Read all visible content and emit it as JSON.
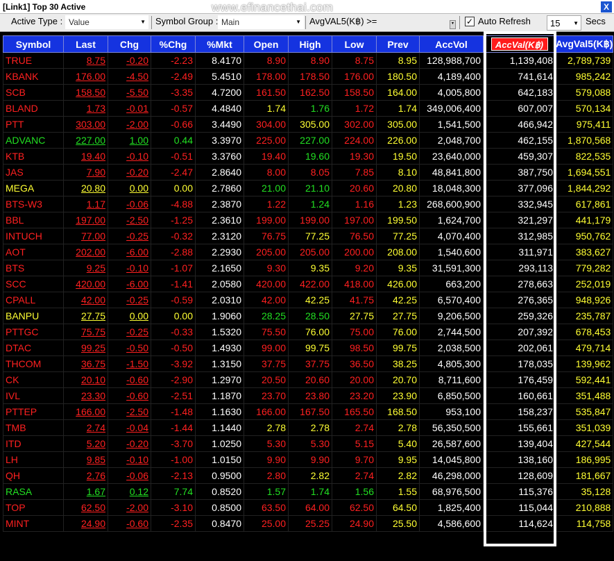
{
  "window": {
    "title": "[Link1] Top 30 Active",
    "watermark": "www.efinancethai.com",
    "close_label": "X"
  },
  "toolbar": {
    "active_type_label": "Active Type :",
    "active_type_value": "Value",
    "symbol_group_label": "Symbol Group :",
    "symbol_group_value": "Main",
    "avgval_label": "AvgVAL5(K฿) >=",
    "auto_refresh_label": "Auto Refresh",
    "auto_refresh_checked": "✓",
    "refresh_value": "15",
    "secs_label": "Secs"
  },
  "columns": [
    "Symbol",
    "Last",
    "Chg",
    "%Chg",
    "%Mkt",
    "Open",
    "High",
    "Low",
    "Prev",
    "AccVol",
    "AccVal(K฿)",
    "AvgVal5(K฿)"
  ],
  "colors": {
    "up": "#22e022",
    "down": "#ff2020",
    "unchanged": "#ffff33",
    "header_bg": "#1533e0"
  },
  "rows": [
    {
      "sym": "TRUE",
      "last": "8.75",
      "chg": "-0.20",
      "pchg": "-2.23",
      "pmkt": "8.4170",
      "open": "8.90",
      "high": "8.90",
      "low": "8.75",
      "prev": "8.95",
      "accvol": "128,988,700",
      "accval": "1,139,408",
      "avgval": "2,789,739",
      "dir": "down",
      "open_c": "red",
      "high_c": "red",
      "low_c": "red"
    },
    {
      "sym": "KBANK",
      "last": "176.00",
      "chg": "-4.50",
      "pchg": "-2.49",
      "pmkt": "5.4510",
      "open": "178.00",
      "high": "178.50",
      "low": "176.00",
      "prev": "180.50",
      "accvol": "4,189,400",
      "accval": "741,614",
      "avgval": "985,242",
      "dir": "down",
      "open_c": "red",
      "high_c": "red",
      "low_c": "red"
    },
    {
      "sym": "SCB",
      "last": "158.50",
      "chg": "-5.50",
      "pchg": "-3.35",
      "pmkt": "4.7200",
      "open": "161.50",
      "high": "162.50",
      "low": "158.50",
      "prev": "164.00",
      "accvol": "4,005,800",
      "accval": "642,183",
      "avgval": "579,088",
      "dir": "down",
      "open_c": "red",
      "high_c": "red",
      "low_c": "red"
    },
    {
      "sym": "BLAND",
      "last": "1.73",
      "chg": "-0.01",
      "pchg": "-0.57",
      "pmkt": "4.4840",
      "open": "1.74",
      "high": "1.76",
      "low": "1.72",
      "prev": "1.74",
      "accvol": "349,006,400",
      "accval": "607,007",
      "avgval": "570,134",
      "dir": "down",
      "open_c": "yellow",
      "high_c": "green",
      "low_c": "red"
    },
    {
      "sym": "PTT",
      "last": "303.00",
      "chg": "-2.00",
      "pchg": "-0.66",
      "pmkt": "3.4490",
      "open": "304.00",
      "high": "305.00",
      "low": "302.00",
      "prev": "305.00",
      "accvol": "1,541,500",
      "accval": "466,942",
      "avgval": "975,411",
      "dir": "down",
      "open_c": "red",
      "high_c": "yellow",
      "low_c": "red"
    },
    {
      "sym": "ADVANC",
      "last": "227.00",
      "chg": "1.00",
      "pchg": "0.44",
      "pmkt": "3.3970",
      "open": "225.00",
      "high": "227.00",
      "low": "224.00",
      "prev": "226.00",
      "accvol": "2,048,700",
      "accval": "462,155",
      "avgval": "1,870,568",
      "dir": "up",
      "open_c": "red",
      "high_c": "green",
      "low_c": "red"
    },
    {
      "sym": "KTB",
      "last": "19.40",
      "chg": "-0.10",
      "pchg": "-0.51",
      "pmkt": "3.3760",
      "open": "19.40",
      "high": "19.60",
      "low": "19.30",
      "prev": "19.50",
      "accvol": "23,640,000",
      "accval": "459,307",
      "avgval": "822,535",
      "dir": "down",
      "open_c": "red",
      "high_c": "green",
      "low_c": "red"
    },
    {
      "sym": "JAS",
      "last": "7.90",
      "chg": "-0.20",
      "pchg": "-2.47",
      "pmkt": "2.8640",
      "open": "8.00",
      "high": "8.05",
      "low": "7.85",
      "prev": "8.10",
      "accvol": "48,841,800",
      "accval": "387,750",
      "avgval": "1,694,551",
      "dir": "down",
      "open_c": "red",
      "high_c": "red",
      "low_c": "red"
    },
    {
      "sym": "MEGA",
      "last": "20.80",
      "chg": "0.00",
      "pchg": "0.00",
      "pmkt": "2.7860",
      "open": "21.00",
      "high": "21.10",
      "low": "20.60",
      "prev": "20.80",
      "accvol": "18,048,300",
      "accval": "377,096",
      "avgval": "1,844,292",
      "dir": "unchanged",
      "open_c": "green",
      "high_c": "green",
      "low_c": "red"
    },
    {
      "sym": "BTS-W3",
      "last": "1.17",
      "chg": "-0.06",
      "pchg": "-4.88",
      "pmkt": "2.3870",
      "open": "1.22",
      "high": "1.24",
      "low": "1.16",
      "prev": "1.23",
      "accvol": "268,600,900",
      "accval": "332,945",
      "avgval": "617,861",
      "dir": "down",
      "open_c": "red",
      "high_c": "green",
      "low_c": "red"
    },
    {
      "sym": "BBL",
      "last": "197.00",
      "chg": "-2.50",
      "pchg": "-1.25",
      "pmkt": "2.3610",
      "open": "199.00",
      "high": "199.00",
      "low": "197.00",
      "prev": "199.50",
      "accvol": "1,624,700",
      "accval": "321,297",
      "avgval": "441,179",
      "dir": "down",
      "open_c": "red",
      "high_c": "red",
      "low_c": "red"
    },
    {
      "sym": "INTUCH",
      "last": "77.00",
      "chg": "-0.25",
      "pchg": "-0.32",
      "pmkt": "2.3120",
      "open": "76.75",
      "high": "77.25",
      "low": "76.50",
      "prev": "77.25",
      "accvol": "4,070,400",
      "accval": "312,985",
      "avgval": "950,762",
      "dir": "down",
      "open_c": "red",
      "high_c": "yellow",
      "low_c": "red"
    },
    {
      "sym": "AOT",
      "last": "202.00",
      "chg": "-6.00",
      "pchg": "-2.88",
      "pmkt": "2.2930",
      "open": "205.00",
      "high": "205.00",
      "low": "200.00",
      "prev": "208.00",
      "accvol": "1,540,600",
      "accval": "311,971",
      "avgval": "383,627",
      "dir": "down",
      "open_c": "red",
      "high_c": "red",
      "low_c": "red"
    },
    {
      "sym": "BTS",
      "last": "9.25",
      "chg": "-0.10",
      "pchg": "-1.07",
      "pmkt": "2.1650",
      "open": "9.30",
      "high": "9.35",
      "low": "9.20",
      "prev": "9.35",
      "accvol": "31,591,300",
      "accval": "293,113",
      "avgval": "779,282",
      "dir": "down",
      "open_c": "red",
      "high_c": "yellow",
      "low_c": "red"
    },
    {
      "sym": "SCC",
      "last": "420.00",
      "chg": "-6.00",
      "pchg": "-1.41",
      "pmkt": "2.0580",
      "open": "420.00",
      "high": "422.00",
      "low": "418.00",
      "prev": "426.00",
      "accvol": "663,200",
      "accval": "278,663",
      "avgval": "252,019",
      "dir": "down",
      "open_c": "red",
      "high_c": "red",
      "low_c": "red"
    },
    {
      "sym": "CPALL",
      "last": "42.00",
      "chg": "-0.25",
      "pchg": "-0.59",
      "pmkt": "2.0310",
      "open": "42.00",
      "high": "42.25",
      "low": "41.75",
      "prev": "42.25",
      "accvol": "6,570,400",
      "accval": "276,365",
      "avgval": "948,926",
      "dir": "down",
      "open_c": "red",
      "high_c": "yellow",
      "low_c": "red"
    },
    {
      "sym": "BANPU",
      "last": "27.75",
      "chg": "0.00",
      "pchg": "0.00",
      "pmkt": "1.9060",
      "open": "28.25",
      "high": "28.50",
      "low": "27.75",
      "prev": "27.75",
      "accvol": "9,206,500",
      "accval": "259,326",
      "avgval": "235,787",
      "dir": "unchanged",
      "open_c": "green",
      "high_c": "green",
      "low_c": "yellow"
    },
    {
      "sym": "PTTGC",
      "last": "75.75",
      "chg": "-0.25",
      "pchg": "-0.33",
      "pmkt": "1.5320",
      "open": "75.50",
      "high": "76.00",
      "low": "75.00",
      "prev": "76.00",
      "accvol": "2,744,500",
      "accval": "207,392",
      "avgval": "678,453",
      "dir": "down",
      "open_c": "red",
      "high_c": "yellow",
      "low_c": "red"
    },
    {
      "sym": "DTAC",
      "last": "99.25",
      "chg": "-0.50",
      "pchg": "-0.50",
      "pmkt": "1.4930",
      "open": "99.00",
      "high": "99.75",
      "low": "98.50",
      "prev": "99.75",
      "accvol": "2,038,500",
      "accval": "202,061",
      "avgval": "479,714",
      "dir": "down",
      "open_c": "red",
      "high_c": "yellow",
      "low_c": "red"
    },
    {
      "sym": "THCOM",
      "last": "36.75",
      "chg": "-1.50",
      "pchg": "-3.92",
      "pmkt": "1.3150",
      "open": "37.75",
      "high": "37.75",
      "low": "36.50",
      "prev": "38.25",
      "accvol": "4,805,300",
      "accval": "178,035",
      "avgval": "139,962",
      "dir": "down",
      "open_c": "red",
      "high_c": "red",
      "low_c": "red"
    },
    {
      "sym": "CK",
      "last": "20.10",
      "chg": "-0.60",
      "pchg": "-2.90",
      "pmkt": "1.2970",
      "open": "20.50",
      "high": "20.60",
      "low": "20.00",
      "prev": "20.70",
      "accvol": "8,711,600",
      "accval": "176,459",
      "avgval": "592,441",
      "dir": "down",
      "open_c": "red",
      "high_c": "red",
      "low_c": "red"
    },
    {
      "sym": "IVL",
      "last": "23.30",
      "chg": "-0.60",
      "pchg": "-2.51",
      "pmkt": "1.1870",
      "open": "23.70",
      "high": "23.80",
      "low": "23.20",
      "prev": "23.90",
      "accvol": "6,850,500",
      "accval": "160,661",
      "avgval": "351,488",
      "dir": "down",
      "open_c": "red",
      "high_c": "red",
      "low_c": "red"
    },
    {
      "sym": "PTTEP",
      "last": "166.00",
      "chg": "-2.50",
      "pchg": "-1.48",
      "pmkt": "1.1630",
      "open": "166.00",
      "high": "167.50",
      "low": "165.50",
      "prev": "168.50",
      "accvol": "953,100",
      "accval": "158,237",
      "avgval": "535,847",
      "dir": "down",
      "open_c": "red",
      "high_c": "red",
      "low_c": "red"
    },
    {
      "sym": "TMB",
      "last": "2.74",
      "chg": "-0.04",
      "pchg": "-1.44",
      "pmkt": "1.1440",
      "open": "2.78",
      "high": "2.78",
      "low": "2.74",
      "prev": "2.78",
      "accvol": "56,350,500",
      "accval": "155,661",
      "avgval": "351,039",
      "dir": "down",
      "open_c": "yellow",
      "high_c": "yellow",
      "low_c": "red"
    },
    {
      "sym": "ITD",
      "last": "5.20",
      "chg": "-0.20",
      "pchg": "-3.70",
      "pmkt": "1.0250",
      "open": "5.30",
      "high": "5.30",
      "low": "5.15",
      "prev": "5.40",
      "accvol": "26,587,600",
      "accval": "139,404",
      "avgval": "427,544",
      "dir": "down",
      "open_c": "red",
      "high_c": "red",
      "low_c": "red"
    },
    {
      "sym": "LH",
      "last": "9.85",
      "chg": "-0.10",
      "pchg": "-1.00",
      "pmkt": "1.0150",
      "open": "9.90",
      "high": "9.90",
      "low": "9.70",
      "prev": "9.95",
      "accvol": "14,045,800",
      "accval": "138,160",
      "avgval": "186,995",
      "dir": "down",
      "open_c": "red",
      "high_c": "red",
      "low_c": "red"
    },
    {
      "sym": "QH",
      "last": "2.76",
      "chg": "-0.06",
      "pchg": "-2.13",
      "pmkt": "0.9500",
      "open": "2.80",
      "high": "2.82",
      "low": "2.74",
      "prev": "2.82",
      "accvol": "46,298,000",
      "accval": "128,609",
      "avgval": "181,667",
      "dir": "down",
      "open_c": "red",
      "high_c": "yellow",
      "low_c": "red"
    },
    {
      "sym": "RASA",
      "last": "1.67",
      "chg": "0.12",
      "pchg": "7.74",
      "pmkt": "0.8520",
      "open": "1.57",
      "high": "1.74",
      "low": "1.56",
      "prev": "1.55",
      "accvol": "68,976,500",
      "accval": "115,376",
      "avgval": "35,128",
      "dir": "up",
      "open_c": "green",
      "high_c": "green",
      "low_c": "green"
    },
    {
      "sym": "TOP",
      "last": "62.50",
      "chg": "-2.00",
      "pchg": "-3.10",
      "pmkt": "0.8500",
      "open": "63.50",
      "high": "64.00",
      "low": "62.50",
      "prev": "64.50",
      "accvol": "1,825,400",
      "accval": "115,044",
      "avgval": "210,888",
      "dir": "down",
      "open_c": "red",
      "high_c": "red",
      "low_c": "red"
    },
    {
      "sym": "MINT",
      "last": "24.90",
      "chg": "-0.60",
      "pchg": "-2.35",
      "pmkt": "0.8470",
      "open": "25.00",
      "high": "25.25",
      "low": "24.90",
      "prev": "25.50",
      "accvol": "4,586,600",
      "accval": "114,624",
      "avgval": "114,758",
      "dir": "down",
      "open_c": "red",
      "high_c": "red",
      "low_c": "red"
    }
  ]
}
